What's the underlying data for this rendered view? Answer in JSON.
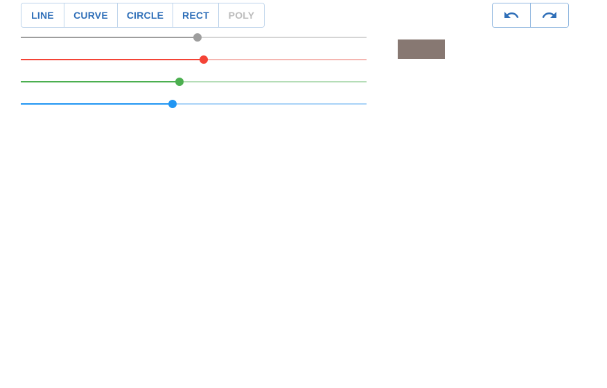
{
  "tools": [
    {
      "label": "LINE",
      "name": "line-tool-button",
      "enabled": true
    },
    {
      "label": "CURVE",
      "name": "curve-tool-button",
      "enabled": true
    },
    {
      "label": "CIRCLE",
      "name": "circle-tool-button",
      "enabled": true
    },
    {
      "label": "RECT",
      "name": "rect-tool-button",
      "enabled": true
    },
    {
      "label": "POLY",
      "name": "poly-tool-button",
      "enabled": false
    }
  ],
  "history": {
    "undo_icon": "undo-icon",
    "redo_icon": "redo-icon",
    "icon_color": "#2f6fb8"
  },
  "sliders": [
    {
      "name": "alpha-slider",
      "value": 0.511,
      "color": "#9e9e9e",
      "track_color": "#d5d5d5"
    },
    {
      "name": "red-slider",
      "value": 0.529,
      "color": "#f44336",
      "track_color": "#f5b6b1"
    },
    {
      "name": "green-slider",
      "value": 0.459,
      "color": "#4caf50",
      "track_color": "#b5ddb7"
    },
    {
      "name": "blue-slider",
      "value": 0.439,
      "color": "#2196f3",
      "track_color": "#a9d3f7"
    }
  ],
  "swatch": {
    "color": "#877872"
  }
}
